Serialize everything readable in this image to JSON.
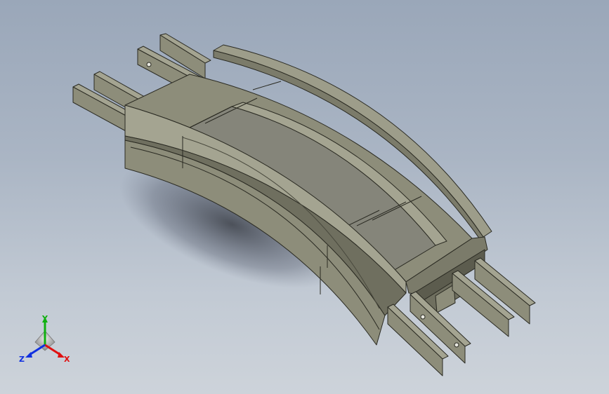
{
  "viewport": {
    "background_top": "#9aa7b9",
    "background_bottom": "#cdd3da",
    "part_color": "#8d8d7a",
    "part_shade": "#6f6f5f",
    "part_light": "#a4a491",
    "edge_color": "#2a2a22"
  },
  "triad": {
    "x_label": "X",
    "y_label": "Y",
    "z_label": "Z",
    "x_color": "#e01010",
    "y_color": "#10b010",
    "z_color": "#1030e0"
  }
}
